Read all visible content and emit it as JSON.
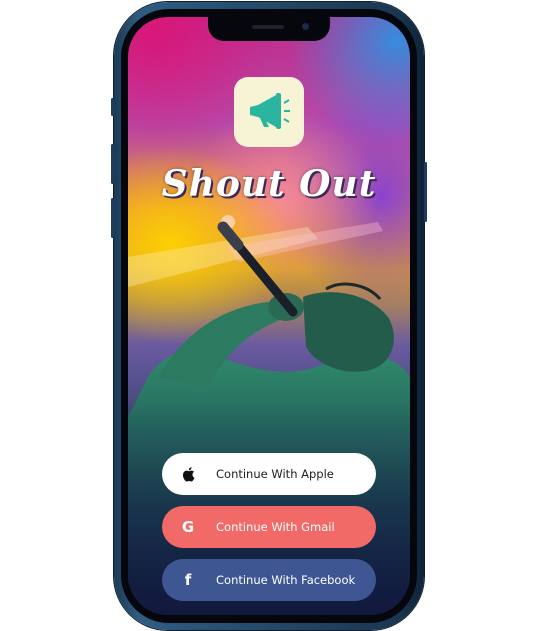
{
  "app": {
    "title": "Shout Out"
  },
  "buttons": {
    "apple": {
      "label": "Continue With Apple",
      "icon": "apple-icon"
    },
    "gmail": {
      "label": "Continue With Gmail",
      "icon": "google-icon",
      "color": "#f26a68"
    },
    "facebook": {
      "label": "Continue With Facebook",
      "icon": "facebook-icon",
      "color": "#3e5793"
    }
  },
  "logo": {
    "icon": "megaphone-icon",
    "background": "#f7f4d5",
    "icon_color": "#2bb5a0"
  }
}
